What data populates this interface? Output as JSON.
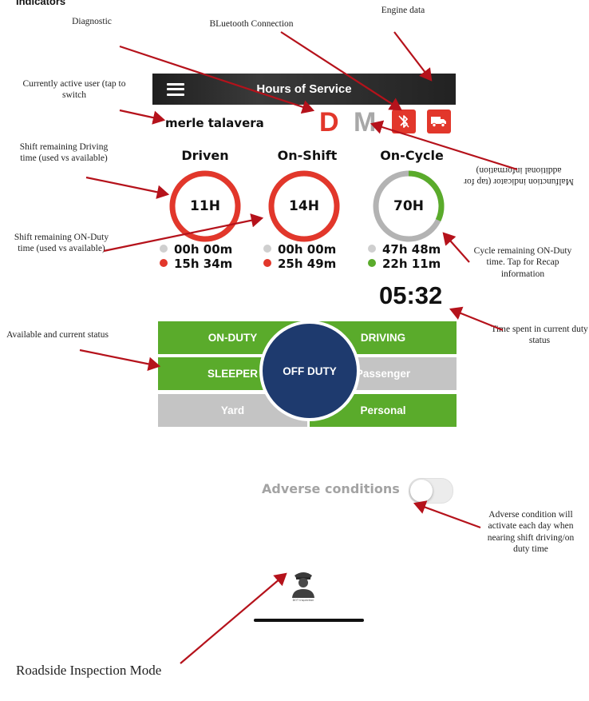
{
  "page_header_partial": "Indicators",
  "app": {
    "title": "Hours of Service",
    "user": "merle talavera",
    "diagnostic_indicator": "D",
    "malfunction_indicator": "M",
    "icons": {
      "menu": "hamburger-menu-icon",
      "bluetooth": "bluetooth-off-icon",
      "engine": "truck-icon",
      "inspection": "officer-icon"
    },
    "colors": {
      "red": "#e2372b",
      "green": "#5aab2b",
      "gray": "#c4c4c4",
      "navy": "#1e3a6e"
    }
  },
  "clocks": [
    {
      "label": "Driven",
      "value": "11H",
      "used": "00h 00m",
      "available": "15h 34m",
      "ring_color": "#e2372b",
      "progress": 1.0
    },
    {
      "label": "On-Shift",
      "value": "14H",
      "used": "00h 00m",
      "available": "25h 49m",
      "ring_color": "#e2372b",
      "progress": 1.0
    },
    {
      "label": "On-Cycle",
      "value": "70H",
      "used": "47h 48m",
      "available": "22h 11m",
      "ring_color": "#5aab2b",
      "progress": 0.32
    }
  ],
  "timer": "05:32",
  "statuses": {
    "on_duty": "ON-DUTY",
    "driving": "DRIVING",
    "sleeper": "SLEEPER",
    "off_duty": "OFF DUTY",
    "passenger": "Passenger",
    "yard": "Yard",
    "personal": "Personal"
  },
  "adverse": {
    "label": "Adverse conditions",
    "enabled": false
  },
  "inspection_button_label": "DOT Inspection",
  "annotations": {
    "diagnostic": "Diagnostic",
    "bluetooth": "BLuetooth Connection",
    "engine": "Engine data",
    "active_user": "Currently active user (tap to switch",
    "malfunction": "Malfunction indicator (tap for additional information)",
    "shift_driving": "Shift remaining Driving time (used vs available)",
    "shift_onduty": "Shift remaining ON-Duty time (used vs available)",
    "cycle": "Cycle remaining ON-Duty time. Tap for Recap information",
    "time_spent": "Time spent in current duty status",
    "available_status": "Available and current status",
    "adverse": "Adverse condition will activate each day when nearing shift driving/on duty time",
    "roadside": "Roadside Inspection Mode"
  }
}
